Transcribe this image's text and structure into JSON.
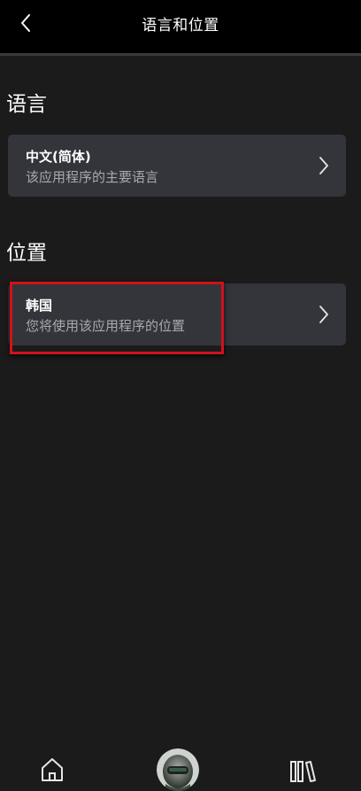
{
  "header": {
    "title": "语言和位置",
    "back_icon": "chevron-left-icon"
  },
  "language_section": {
    "heading": "语言",
    "card": {
      "title": "中文(简体)",
      "subtitle": "该应用程序的主要语言",
      "icon": "chevron-right-icon"
    }
  },
  "location_section": {
    "heading": "位置",
    "card": {
      "title": "韩国",
      "subtitle": "您将使用该应用程序的位置",
      "icon": "chevron-right-icon"
    }
  },
  "bottom_nav": {
    "items": [
      {
        "icon": "home-icon"
      },
      {
        "icon": "avatar"
      },
      {
        "icon": "library-icon"
      }
    ]
  },
  "colors": {
    "background": "#1b1b1b",
    "header": "#000000",
    "card": "#34353b",
    "subtitle_text": "#a8a9ae",
    "highlight": "#d0121b"
  }
}
